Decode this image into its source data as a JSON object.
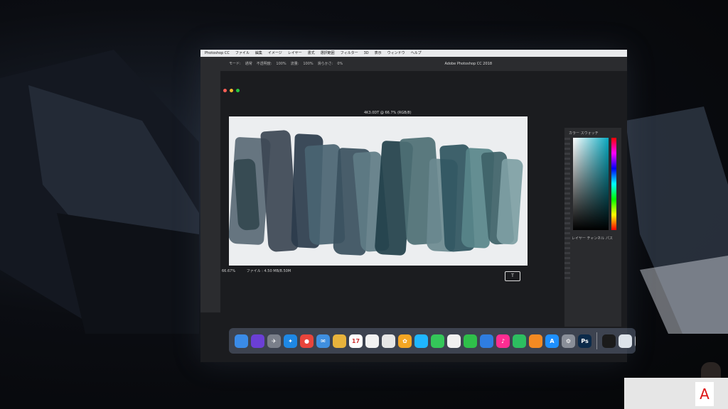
{
  "window": {
    "app_title": "Adobe Photoshop CC 2018",
    "doc_title": "4K3.0DT @ 66.7% (RGB/8)",
    "menu_items": [
      "Photoshop CC",
      "ファイル",
      "編集",
      "イメージ",
      "レイヤー",
      "書式",
      "選択範囲",
      "フィルター",
      "3D",
      "表示",
      "ウィンドウ",
      "ヘルプ"
    ],
    "options": [
      "モード:",
      "通常",
      "不透明度:",
      "100%",
      "流量:",
      "100%",
      "滑らかさ:",
      "0%"
    ]
  },
  "canvas": {
    "stroke_colors": [
      "#5a6a76",
      "#3c4654",
      "#2b3c4c",
      "#4a6472",
      "#39505e",
      "#5f7c86",
      "#22404a",
      "#4d6f74",
      "#6b8a90",
      "#2f5560",
      "#58858a",
      "#3e6268",
      "#7ea0a4",
      "#33484f"
    ]
  },
  "status": {
    "zoom": "66.67%",
    "file_info": "ファイル : 4.50 MB/8.50M"
  },
  "color_panel": {
    "tab_label": "カラー  スウォッチ",
    "sub_label": "レイヤー  チャンネル  パス",
    "current_color": "#0aa9c0"
  },
  "cursor_label": "T",
  "dock": {
    "icons": [
      {
        "name": "finder-icon",
        "color": "#3a8be8",
        "glyph": ""
      },
      {
        "name": "siri-icon",
        "color": "#6b3fd6",
        "glyph": ""
      },
      {
        "name": "launchpad-icon",
        "color": "#7a7f8a",
        "glyph": "✈"
      },
      {
        "name": "safari-icon",
        "color": "#1e88e5",
        "glyph": "✦"
      },
      {
        "name": "chrome-icon",
        "color": "#e8453c",
        "glyph": "●"
      },
      {
        "name": "mail-icon",
        "color": "#3f8fe0",
        "glyph": "✉"
      },
      {
        "name": "notes-icon",
        "color": "#e8b33c",
        "glyph": ""
      },
      {
        "name": "calendar-icon",
        "color": "#ffffff",
        "glyph": "17"
      },
      {
        "name": "reminders-icon",
        "color": "#f2f2f2",
        "glyph": ""
      },
      {
        "name": "preview-icon",
        "color": "#e6e6e6",
        "glyph": ""
      },
      {
        "name": "photos-icon",
        "color": "#f5a623",
        "glyph": "✿"
      },
      {
        "name": "messages-icon",
        "color": "#1fb6ff",
        "glyph": ""
      },
      {
        "name": "facetime-icon",
        "color": "#34c759",
        "glyph": ""
      },
      {
        "name": "pages-icon",
        "color": "#f0f0f0",
        "glyph": ""
      },
      {
        "name": "numbers-icon",
        "color": "#2fbf4a",
        "glyph": ""
      },
      {
        "name": "keynote-icon",
        "color": "#2f7de0",
        "glyph": ""
      },
      {
        "name": "itunes-icon",
        "color": "#ff2d92",
        "glyph": "♪"
      },
      {
        "name": "evernote-icon",
        "color": "#2dbe60",
        "glyph": ""
      },
      {
        "name": "ibooks-icon",
        "color": "#f48a22",
        "glyph": ""
      },
      {
        "name": "appstore-icon",
        "color": "#1e90ff",
        "glyph": "A"
      },
      {
        "name": "system-preferences-icon",
        "color": "#8a8f99",
        "glyph": "⚙"
      },
      {
        "name": "photoshop-icon",
        "color": "#0b2a4a",
        "glyph": "Ps"
      },
      {
        "name": "terminal-icon",
        "color": "#1b1b1b",
        "glyph": ""
      },
      {
        "name": "document-icon",
        "color": "#dde3ea",
        "glyph": ""
      },
      {
        "name": "trash-icon",
        "color": "#c8ccd2",
        "glyph": ""
      }
    ]
  },
  "podium": {
    "logo_text": "A"
  }
}
